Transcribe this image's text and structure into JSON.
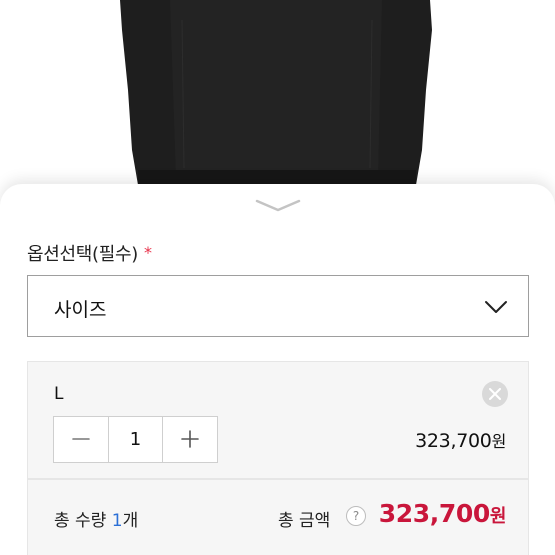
{
  "option": {
    "title": "옵션선택(필수)",
    "required_mark": "*"
  },
  "size_select": {
    "selected": "사이즈"
  },
  "selected_item": {
    "size": "L",
    "quantity": "1",
    "price": "323,700",
    "currency": "원"
  },
  "summary": {
    "qty_prefix": "총 수량 ",
    "qty_value": "1",
    "qty_unit": "개",
    "total_label": "총 금액",
    "help": "?",
    "total_price": "323,700",
    "currency": "원"
  },
  "colors": {
    "accent_red": "#c9163b",
    "qty_blue": "#2b6fd6",
    "required_red": "#e8324a"
  },
  "icons": [
    "chevron-down-icon",
    "close-icon",
    "minus-icon",
    "plus-icon",
    "help-icon",
    "sheet-handle-icon"
  ]
}
